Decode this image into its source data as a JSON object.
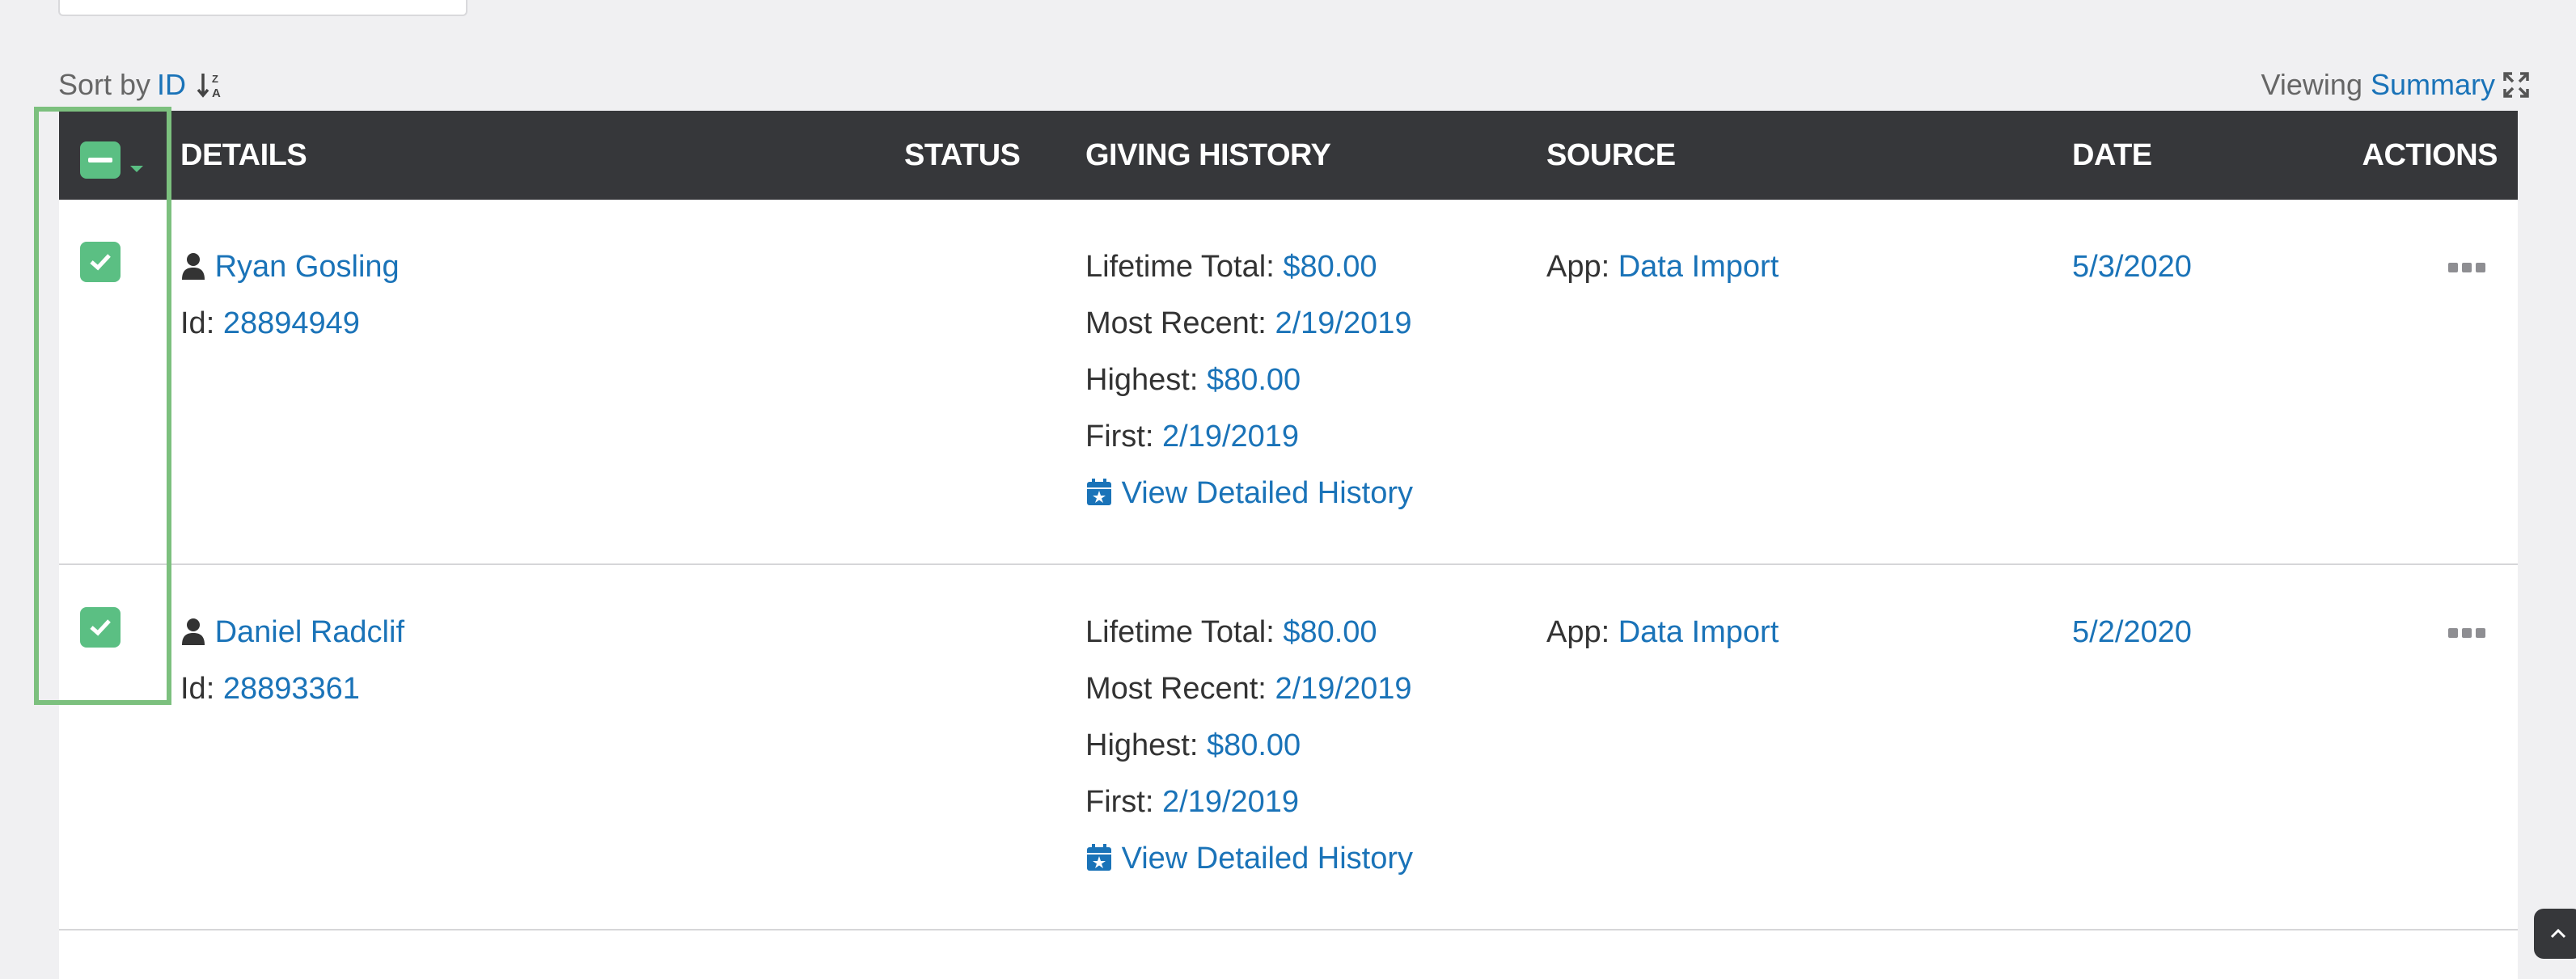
{
  "sort": {
    "label": "Sort by",
    "field": "ID"
  },
  "view": {
    "label": "Viewing",
    "mode": "Summary"
  },
  "columns": [
    "DETAILS",
    "STATUS",
    "GIVING HISTORY",
    "SOURCE",
    "DATE",
    "ACTIONS"
  ],
  "colors": {
    "header_bg": "#36373a",
    "link": "#1a73b8",
    "checkbox": "#5bbf83",
    "highlight": "#7cc07e"
  },
  "labels": {
    "id": "Id:",
    "lifetime": "Lifetime Total:",
    "recent": "Most Recent:",
    "highest": "Highest:",
    "first": "First:",
    "view_history": "View Detailed History",
    "app": "App:"
  },
  "rows": [
    {
      "name": "Ryan Gosling",
      "id": "28894949",
      "status": "",
      "lifetime_total": "$80.00",
      "most_recent": "2/19/2019",
      "highest": "$80.00",
      "first": "2/19/2019",
      "source": "Data Import",
      "date": "5/3/2020",
      "checked": true
    },
    {
      "name": "Daniel Radclif",
      "id": "28893361",
      "status": "",
      "lifetime_total": "$80.00",
      "most_recent": "2/19/2019",
      "highest": "$80.00",
      "first": "2/19/2019",
      "source": "Data Import",
      "date": "5/2/2020",
      "checked": true
    }
  ]
}
